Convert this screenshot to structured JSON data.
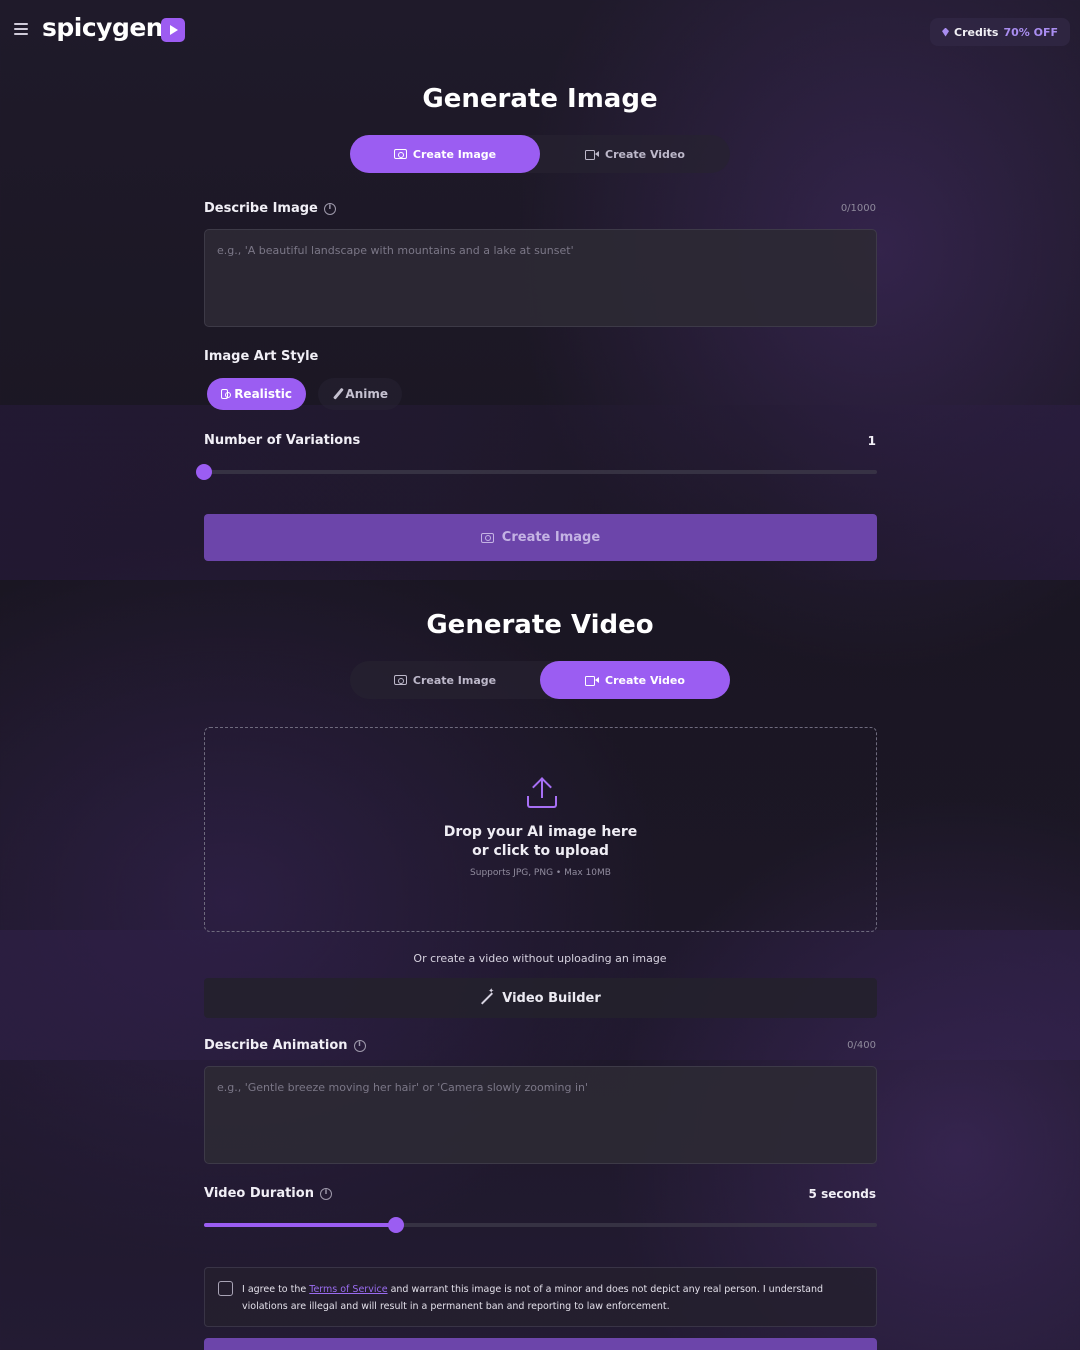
{
  "header": {
    "logo": "spicygen",
    "credits_label": "Credits",
    "credits_discount": "70% OFF"
  },
  "image_section": {
    "title": "Generate Image",
    "tabs": [
      {
        "label": "Create Image"
      },
      {
        "label": "Create Video"
      }
    ],
    "active_tab": 0,
    "describe_label": "Describe Image",
    "describe_counter": "0/1000",
    "describe_placeholder": "e.g., 'A beautiful landscape with mountains and a lake at sunset'",
    "style_label": "Image Art Style",
    "styles": [
      {
        "label": "Realistic",
        "icon": "camera-icon"
      },
      {
        "label": "Anime",
        "icon": "brush-icon"
      }
    ],
    "selected_style": "Realistic",
    "variations_label": "Number of Variations",
    "variations_value": "1",
    "variations_slider_fraction": 0.0,
    "create_button": "Create Image"
  },
  "video_section": {
    "title": "Generate Video",
    "tabs": [
      {
        "label": "Create Image"
      },
      {
        "label": "Create Video"
      }
    ],
    "active_tab": 1,
    "upload_title_line1": "Drop your AI image here",
    "upload_title_line2": "or click to upload",
    "upload_sub": "Supports JPG, PNG • Max 10MB",
    "or_text": "Or create a video without uploading an image",
    "builder_button": "Video Builder",
    "animation_label": "Describe Animation",
    "animation_counter": "0/400",
    "animation_placeholder": "e.g., 'Gentle breeze moving her hair' or 'Camera slowly zooming in'",
    "duration_label": "Video Duration",
    "duration_value": "5 seconds",
    "duration_slider_fraction": 0.286,
    "agree_prefix": "I agree to the ",
    "agree_link": "Terms of Service",
    "agree_suffix": " and warrant this image is not of a minor and does not depict any real person. I understand violations are illegal and will result in a permanent ban and reporting to law enforcement."
  },
  "colors": {
    "accent": "#9b5df2",
    "button_dim": "#6c45aa",
    "background": "#1c1726"
  }
}
